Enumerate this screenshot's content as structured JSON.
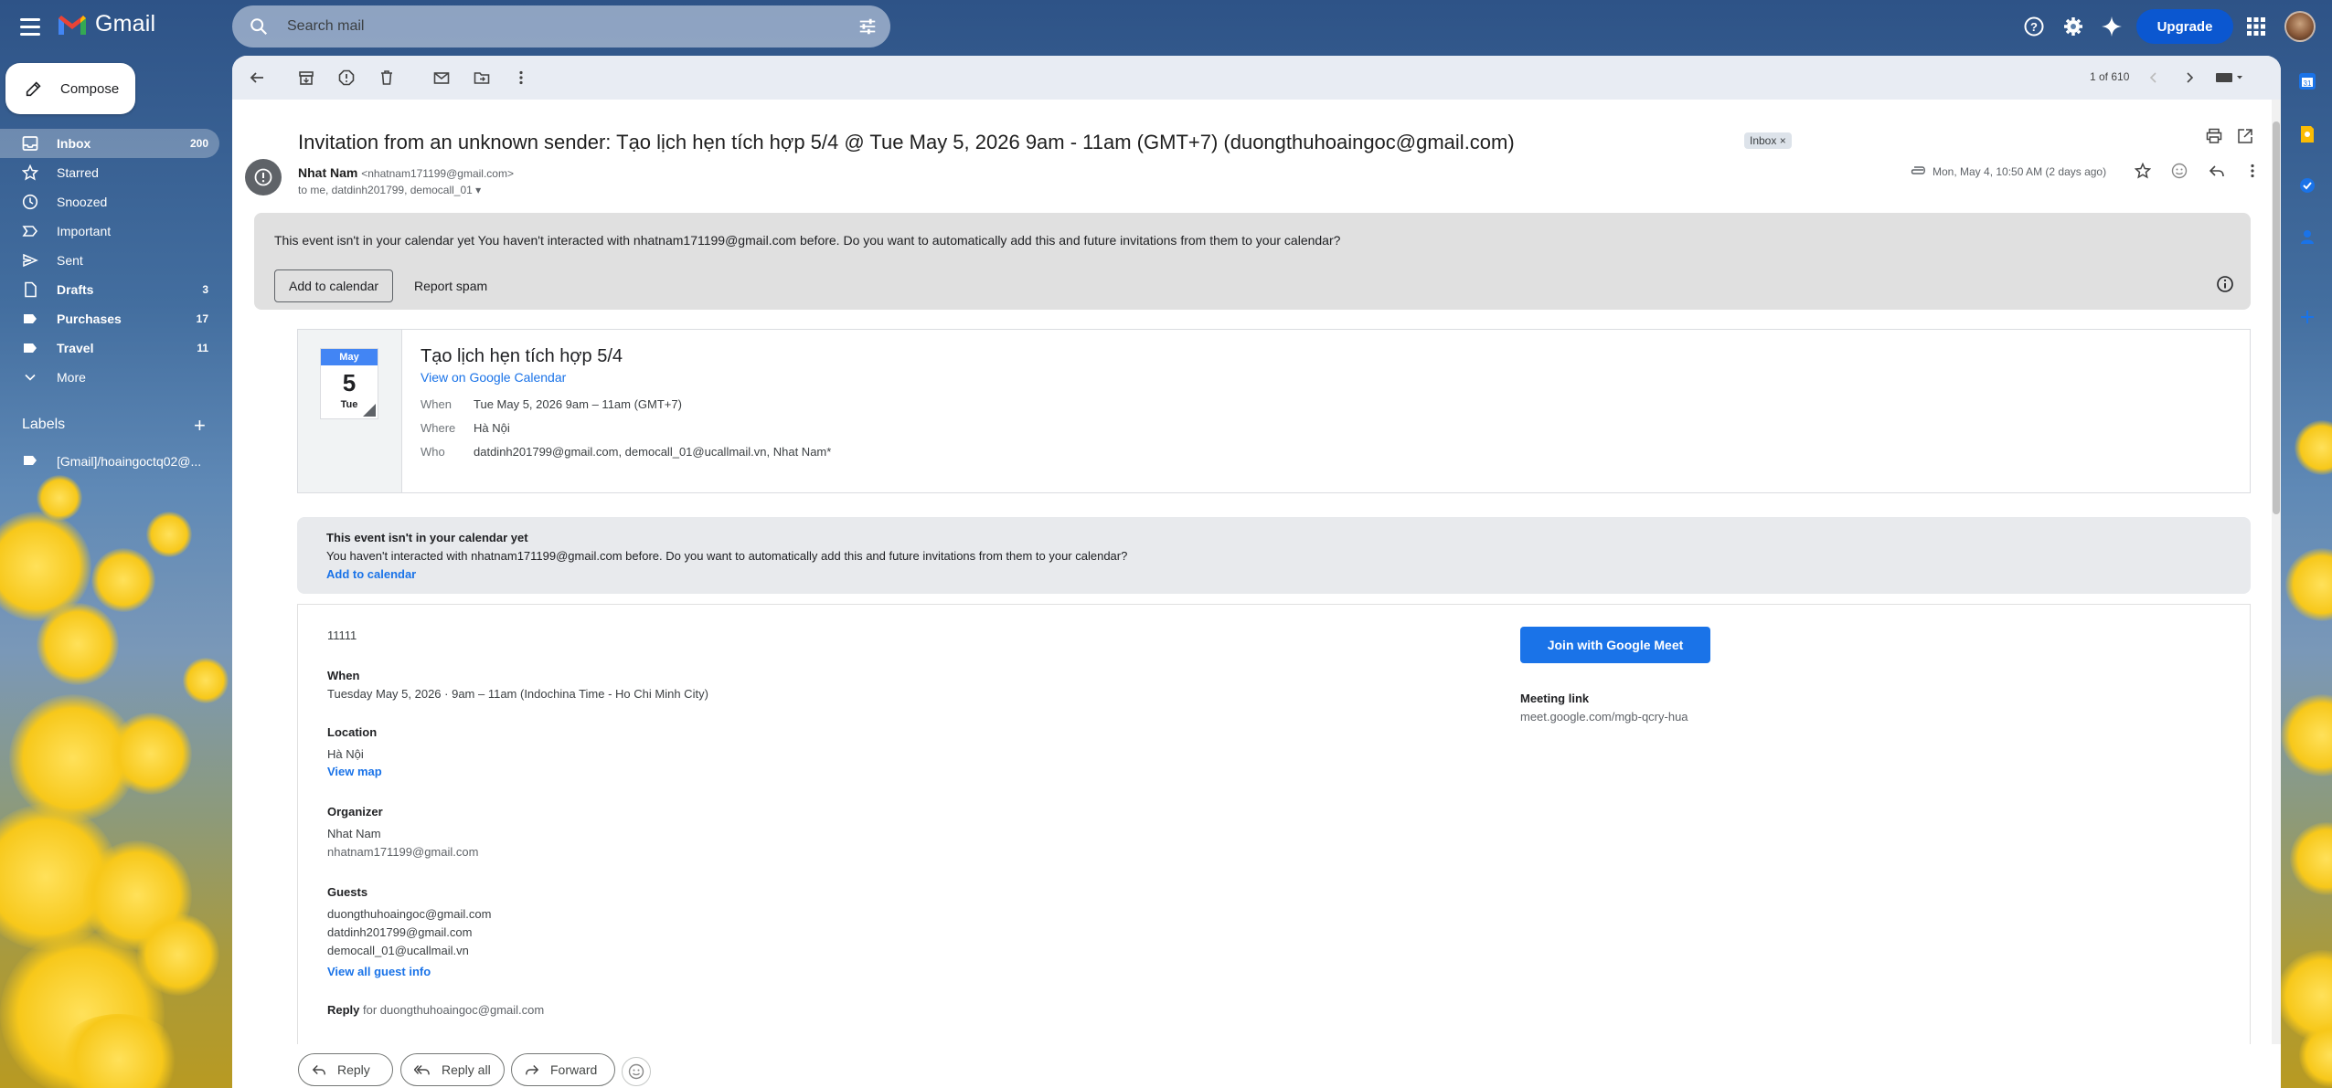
{
  "app": {
    "name": "Gmail"
  },
  "search": {
    "placeholder": "Search mail"
  },
  "header": {
    "upgrade_label": "Upgrade"
  },
  "compose": {
    "label": "Compose"
  },
  "sidebar": {
    "items": [
      {
        "label": "Inbox",
        "count": "200",
        "icon": "inbox-icon"
      },
      {
        "label": "Starred",
        "count": "",
        "icon": "star-icon"
      },
      {
        "label": "Snoozed",
        "count": "",
        "icon": "clock-icon"
      },
      {
        "label": "Important",
        "count": "",
        "icon": "important-icon"
      },
      {
        "label": "Sent",
        "count": "",
        "icon": "send-icon"
      },
      {
        "label": "Drafts",
        "count": "3",
        "icon": "draft-icon"
      },
      {
        "label": "Purchases",
        "count": "17",
        "icon": "tag-icon"
      },
      {
        "label": "Travel",
        "count": "11",
        "icon": "tag-icon"
      },
      {
        "label": "More",
        "count": "",
        "icon": "chevron-down-icon"
      }
    ],
    "labels_heading": "Labels",
    "label_items": [
      {
        "label": "[Gmail]/hoaingoctq02@..."
      }
    ]
  },
  "toolbar": {
    "pager": "1 of 610"
  },
  "message": {
    "subject": "Invitation from an unknown sender: Tạo lịch hẹn tích hợp 5/4 @ Tue May 5, 2026 9am - 11am (GMT+7) (duongthuhoaingoc@gmail.com)",
    "chip": "Inbox ×",
    "sender_name": "Nhat Nam",
    "sender_email": "<nhatnam171199@gmail.com>",
    "to_line": "to me, datdinh201799, democall_01 ▾",
    "date": "Mon, May 4, 10:50 AM (2 days ago)"
  },
  "banner1": {
    "bold": "This event isn't in your calendar yet",
    "text": " You haven't interacted with nhatnam171199@gmail.com before. Do you want to automatically add this and future invitations from them to your calendar?",
    "add_btn": "Add to calendar",
    "spam_btn": "Report spam"
  },
  "event": {
    "month": "May",
    "day": "5",
    "weekday": "Tue",
    "title": "Tạo lịch hẹn tích hợp 5/4",
    "view_link": "View on Google Calendar",
    "when_k": "When",
    "when_v": "Tue May 5, 2026 9am – 11am (GMT+7)",
    "where_k": "Where",
    "where_v": "Hà Nội",
    "who_k": "Who",
    "who_v": "datdinh201799@gmail.com, democall_01@ucallmail.vn, Nhat Nam*"
  },
  "banner2": {
    "l1": "This event isn't in your calendar yet",
    "l2": "You haven't interacted with nhatnam171199@gmail.com before. Do you want to automatically add this and future invitations from them to your calendar?",
    "l3": "Add to calendar"
  },
  "invite": {
    "desc": "11111",
    "when_h": "When",
    "when_v": "Tuesday May 5, 2026 · 9am – 11am (Indochina Time - Ho Chi Minh City)",
    "loc_h": "Location",
    "loc_v": "Hà Nội",
    "view_map": "View map",
    "org_h": "Organizer",
    "org_name": "Nhat Nam",
    "org_email": "nhatnam171199@gmail.com",
    "guests_h": "Guests",
    "guests": [
      "duongthuhoaingoc@gmail.com",
      "datdinh201799@gmail.com",
      "democall_01@ucallmail.vn"
    ],
    "view_guests": "View all guest info",
    "reply_b": "Reply",
    "reply_for": " for duongthuhoaingoc@gmail.com",
    "meet_btn": "Join with Google Meet",
    "meeting_link_h": "Meeting link",
    "meeting_link": "meet.google.com/mgb-qcry-hua"
  },
  "reply_bar": {
    "reply": "Reply",
    "reply_all": "Reply all",
    "forward": "Forward"
  },
  "colors": {
    "accent": "#0b57d0",
    "link": "#1a73e8",
    "calendar": "#4285f4"
  }
}
